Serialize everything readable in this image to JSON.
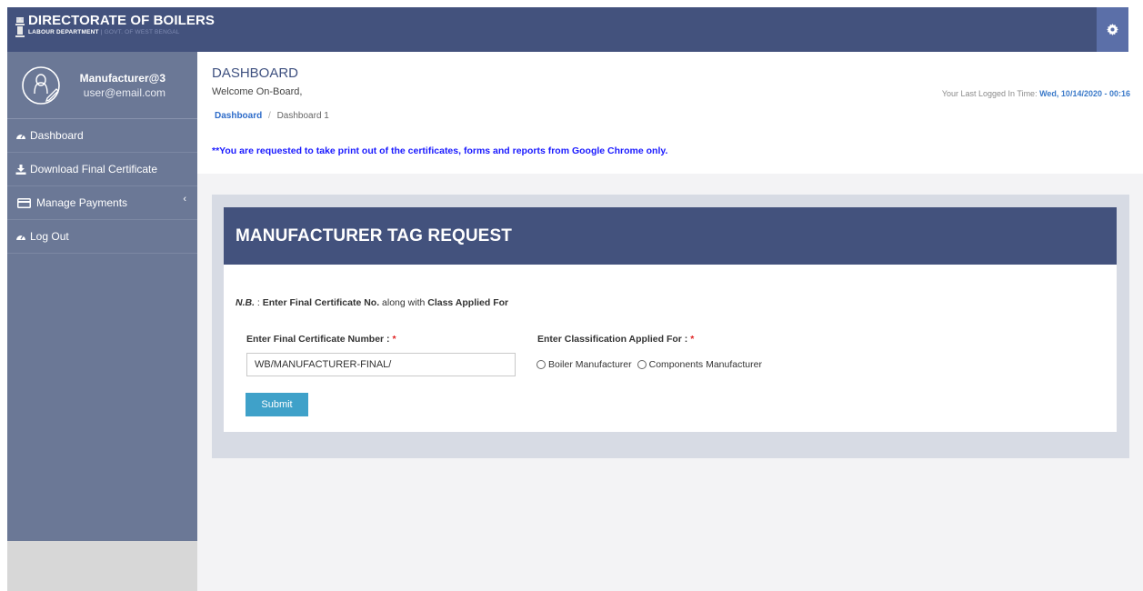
{
  "header": {
    "title": "DIRECTORATE OF BOILERS",
    "subtitle_dept": "LABOUR DEPARTMENT",
    "subtitle_sep": "|",
    "subtitle_govt": "GOVT. OF WEST BENGAL",
    "brand_color": "#43527d",
    "settings_icon": "gear-icon"
  },
  "sidebar": {
    "profile": {
      "name": "Manufacturer@3",
      "email": "user@email.com",
      "avatar_icon": "user-avatar-icon"
    },
    "items": [
      {
        "label": "Dashboard",
        "icon": "dashboard-icon"
      },
      {
        "label": "Download Final Certificate",
        "icon": "download-icon"
      },
      {
        "label": "Manage Payments",
        "icon": "credit-card-icon",
        "chevron": "‹"
      },
      {
        "label": "Log Out",
        "icon": "dashboard-icon"
      }
    ]
  },
  "page": {
    "title": "DASHBOARD",
    "welcome": "Welcome On-Board,",
    "last_login_label": "Your Last Logged In Time:",
    "last_login_value": "Wed, 10/14/2020 - 00:16",
    "breadcrumb": {
      "home": "Dashboard",
      "separator": "/",
      "current": "Dashboard 1"
    },
    "notice": "**You are requested to take print out of the certificates, forms and reports from Google Chrome only."
  },
  "form": {
    "heading": "MANUFACTURER TAG REQUEST",
    "nb_prefix": "N.B.",
    "nb_colon": " : ",
    "nb_bold1": "Enter Final Certificate No.",
    "nb_mid": " along with ",
    "nb_bold2": "Class Applied For",
    "cert_label": "Enter Final Certificate Number : ",
    "class_label": "Enter Classification Applied For : ",
    "required_mark": "*",
    "cert_value": "WB/MANUFACTURER-FINAL/",
    "options": [
      "Boiler Manufacturer",
      "Components Manufacturer"
    ],
    "submit_label": "Submit"
  }
}
